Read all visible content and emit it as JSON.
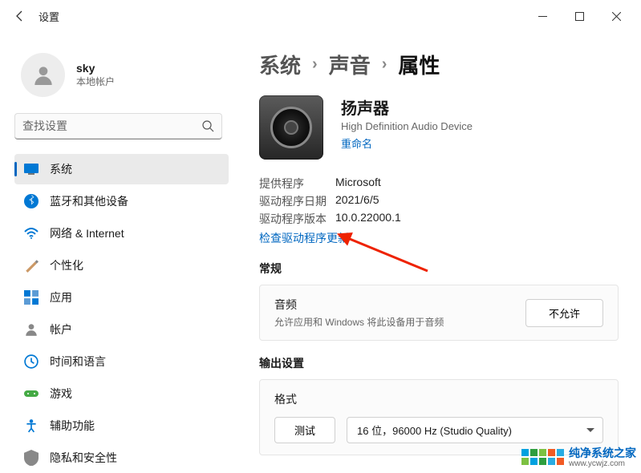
{
  "window": {
    "title": "设置"
  },
  "user": {
    "name": "sky",
    "sub": "本地帐户"
  },
  "search": {
    "placeholder": "查找设置"
  },
  "nav": [
    {
      "label": "系统",
      "icon": "system"
    },
    {
      "label": "蓝牙和其他设备",
      "icon": "bluetooth"
    },
    {
      "label": "网络 & Internet",
      "icon": "wifi"
    },
    {
      "label": "个性化",
      "icon": "personalize"
    },
    {
      "label": "应用",
      "icon": "apps"
    },
    {
      "label": "帐户",
      "icon": "accounts"
    },
    {
      "label": "时间和语言",
      "icon": "time"
    },
    {
      "label": "游戏",
      "icon": "gaming"
    },
    {
      "label": "辅助功能",
      "icon": "accessibility"
    },
    {
      "label": "隐私和安全性",
      "icon": "privacy"
    }
  ],
  "breadcrumb": {
    "root": "系统",
    "mid": "声音",
    "current": "属性"
  },
  "device": {
    "name": "扬声器",
    "sub": "High Definition Audio Device",
    "rename": "重命名"
  },
  "driver": {
    "providerLabel": "提供程序",
    "provider": "Microsoft",
    "dateLabel": "驱动程序日期",
    "date": "2021/6/5",
    "versionLabel": "驱动程序版本",
    "version": "10.0.22000.1",
    "check": "检查驱动程序更新"
  },
  "general": {
    "heading": "常规",
    "audioTitle": "音频",
    "audioSub": "允许应用和 Windows 将此设备用于音频",
    "denyBtn": "不允许"
  },
  "output": {
    "heading": "输出设置",
    "formatTitle": "格式",
    "testBtn": "测试",
    "formatValue": "16 位，96000 Hz (Studio Quality)"
  },
  "watermark": {
    "main": "纯净系统之家",
    "sub": "www.ycwjz.com"
  }
}
